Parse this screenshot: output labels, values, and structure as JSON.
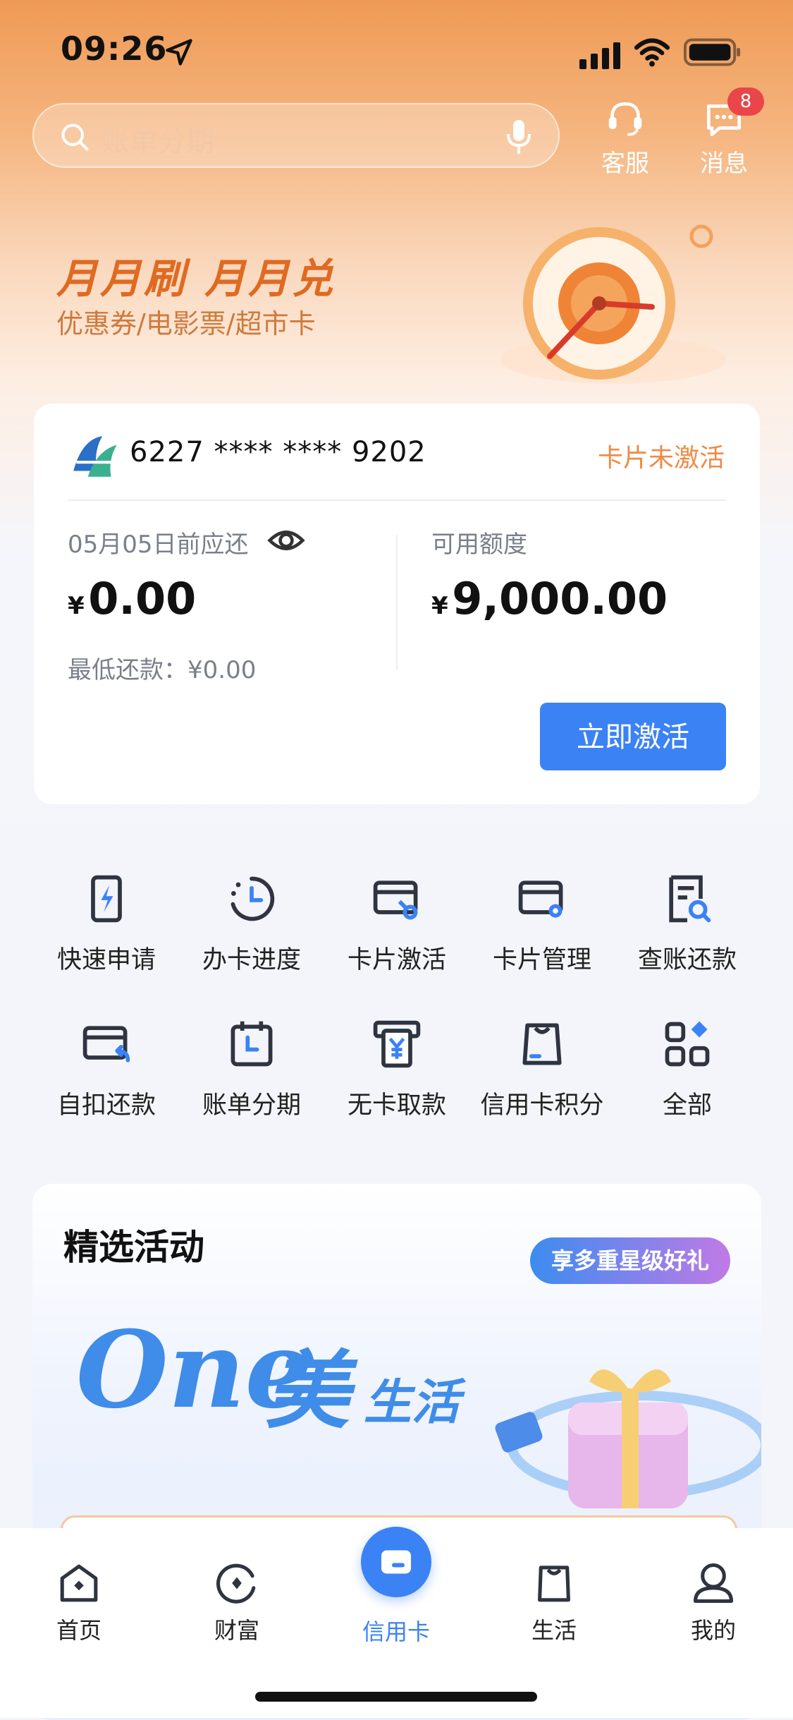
{
  "status_bar": {
    "time": "09:26"
  },
  "search": {
    "placeholder": "账单分期"
  },
  "top_actions": {
    "customer_service": "客服",
    "messages": "消息",
    "messages_badge": "8"
  },
  "banner": {
    "title": "月月刷  月月兑",
    "subtitle": "优惠券/电影票/超市卡"
  },
  "card": {
    "number": "6227 **** **** 9202",
    "status": "卡片未激活",
    "due_label": "05月05日前应还",
    "currency": "¥",
    "due_amount": "0.00",
    "min_payment": "最低还款：¥0.00",
    "available_label": "可用额度",
    "available_amount": "9,000.00",
    "activate_button": "立即激活"
  },
  "services": [
    {
      "label": "快速申请",
      "icon": "phone-flash-icon"
    },
    {
      "label": "办卡进度",
      "icon": "progress-clock-icon"
    },
    {
      "label": "卡片激活",
      "icon": "card-key-icon"
    },
    {
      "label": "卡片管理",
      "icon": "card-settings-icon"
    },
    {
      "label": "查账还款",
      "icon": "bill-search-icon"
    },
    {
      "label": "自扣还款",
      "icon": "card-return-icon"
    },
    {
      "label": "账单分期",
      "icon": "calendar-icon"
    },
    {
      "label": "无卡取款",
      "icon": "atm-yuan-icon"
    },
    {
      "label": "信用卡积分",
      "icon": "bag-icon"
    },
    {
      "label": "全部",
      "icon": "grid-all-icon"
    }
  ],
  "activities": {
    "title": "精选活动",
    "pill": "享多重星级好礼",
    "brand_one": "One",
    "brand_mei": "美",
    "brand_life": "生活"
  },
  "tabbar": [
    {
      "label": "首页"
    },
    {
      "label": "财富"
    },
    {
      "label": "信用卡"
    },
    {
      "label": "生活"
    },
    {
      "label": "我的"
    }
  ],
  "colors": {
    "accent": "#3b82f5",
    "orange": "#ef8a46",
    "badge": "#e9454a"
  }
}
